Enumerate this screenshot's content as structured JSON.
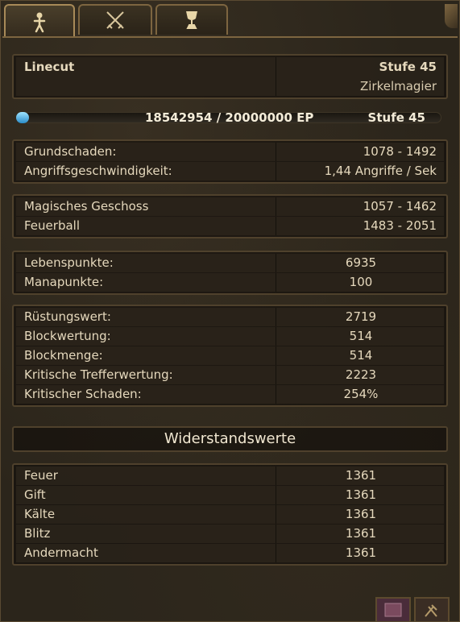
{
  "character": {
    "name": "Linecut",
    "level_label": "Stufe 45",
    "class_name": "Zirkelmagier"
  },
  "experience": {
    "current": 18542954,
    "max": 20000000,
    "text": "18542954  /  20000000  EP",
    "level_label": "Stufe 45",
    "progress_fraction": 0.03
  },
  "damage": [
    {
      "label": "Grundschaden:",
      "value": "1078  -  1492"
    },
    {
      "label": "Angriffsgeschwindigkeit:",
      "value": "1,44  Angriffe  /  Sek"
    }
  ],
  "skills": [
    {
      "label": "Magisches  Geschoss",
      "value": "1057  -  1462"
    },
    {
      "label": "Feuerball",
      "value": "1483  -  2051"
    }
  ],
  "vitals": [
    {
      "label": "Lebenspunkte:",
      "value": "6935"
    },
    {
      "label": "Manapunkte:",
      "value": "100"
    }
  ],
  "defense": [
    {
      "label": "Rüstungswert:",
      "value": "2719"
    },
    {
      "label": "Blockwertung:",
      "value": "514"
    },
    {
      "label": "Blockmenge:",
      "value": "514"
    },
    {
      "label": "Kritische  Trefferwertung:",
      "value": "2223"
    },
    {
      "label": "Kritischer  Schaden:",
      "value": "254%"
    }
  ],
  "resistance_title": "Widerstandswerte",
  "resistances": [
    {
      "label": "Feuer",
      "value": "1361"
    },
    {
      "label": "Gift",
      "value": "1361"
    },
    {
      "label": "Kälte",
      "value": "1361"
    },
    {
      "label": "Blitz",
      "value": "1361"
    },
    {
      "label": "Andermacht",
      "value": "1361"
    }
  ],
  "tabs": [
    {
      "icon": "character-icon",
      "active": true
    },
    {
      "icon": "crossed-swords-icon",
      "active": false
    },
    {
      "icon": "trophy-icon",
      "active": false
    }
  ],
  "colors": {
    "xp_fill": "#2a8cc8",
    "panel_border": "#4f412c",
    "text": "#e6d9bd"
  }
}
